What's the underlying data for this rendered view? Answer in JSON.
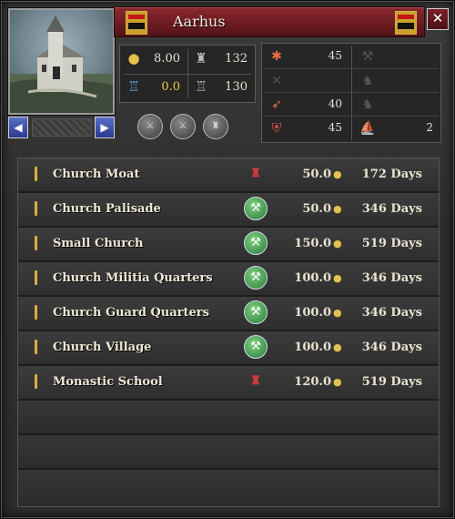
{
  "province": {
    "name": "Aarhus"
  },
  "window": {
    "close_label": "✕"
  },
  "nav": {
    "prev_label": "◀",
    "next_label": "▶"
  },
  "stats": {
    "income": "8.00",
    "garrison": "132",
    "tech": "0.0",
    "fort": "130"
  },
  "levies": {
    "light_infantry": "45",
    "heavy_infantry": "",
    "pikemen": "",
    "light_cavalry": "",
    "archers": "40",
    "knights": "",
    "levy_total": "45",
    "galleys": "2"
  },
  "buildings": [
    {
      "name": "Church Moat",
      "status": "locked",
      "cost": "50.0",
      "time": "172 Days"
    },
    {
      "name": "Church Palisade",
      "status": "buildable",
      "cost": "50.0",
      "time": "346 Days"
    },
    {
      "name": "Small Church",
      "status": "buildable",
      "cost": "150.0",
      "time": "519 Days"
    },
    {
      "name": "Church Militia Quarters",
      "status": "buildable",
      "cost": "100.0",
      "time": "346 Days"
    },
    {
      "name": "Church Guard Quarters",
      "status": "buildable",
      "cost": "100.0",
      "time": "346 Days"
    },
    {
      "name": "Church Village",
      "status": "buildable",
      "cost": "100.0",
      "time": "346 Days"
    },
    {
      "name": "Monastic School",
      "status": "locked",
      "cost": "120.0",
      "time": "519 Days"
    }
  ]
}
